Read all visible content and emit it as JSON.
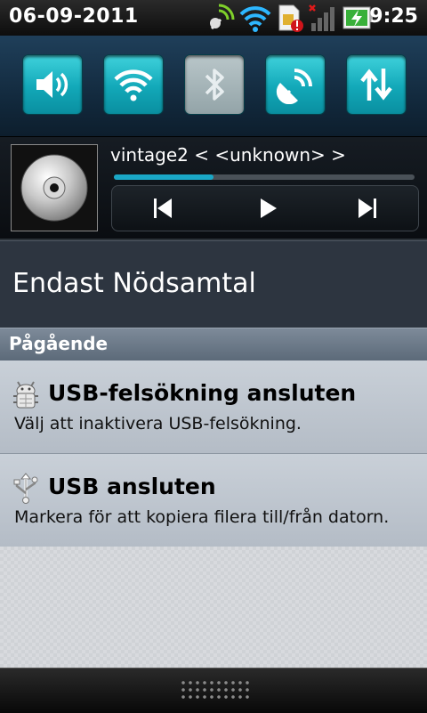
{
  "status_bar": {
    "date": "06-09-2011",
    "time": "9:25",
    "icons": [
      "gps-icon",
      "wifi-icon",
      "sim-alert-icon",
      "signal-icon",
      "battery-charging-icon"
    ]
  },
  "quick_toggles": [
    {
      "name": "sound-toggle",
      "icon": "speaker-icon",
      "state": "on"
    },
    {
      "name": "wifi-toggle",
      "icon": "wifi-icon",
      "state": "on"
    },
    {
      "name": "bluetooth-toggle",
      "icon": "bluetooth-icon",
      "state": "off"
    },
    {
      "name": "gps-toggle",
      "icon": "gps-dish-icon",
      "state": "on"
    },
    {
      "name": "data-toggle",
      "icon": "data-arrows-icon",
      "state": "on"
    }
  ],
  "player": {
    "track": "vintage2 < <unknown> >",
    "progress": 0.33,
    "controls": [
      "previous-icon",
      "play-icon",
      "next-icon"
    ]
  },
  "carrier": {
    "text": "Endast Nödsamtal"
  },
  "section": {
    "title": "Pågående"
  },
  "notifications": [
    {
      "title": "USB-felsökning ansluten",
      "text": "Välj att inaktivera USB-felsökning.",
      "icon": "android-debug-icon"
    },
    {
      "title": "USB ansluten",
      "text": "Markera för att kopiera filera till/från datorn.",
      "icon": "usb-icon"
    }
  ],
  "colors": {
    "accent": "#1aa7c6",
    "toggle_on": "#12a8b8",
    "toggle_off": "#a3b1b5"
  }
}
